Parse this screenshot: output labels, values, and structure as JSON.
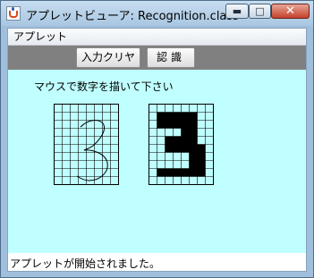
{
  "window": {
    "title": "アプレットビューア: Recognition.class",
    "minimize_symbol": "▬",
    "maximize_symbol": "□",
    "close_symbol": "✕"
  },
  "menu": {
    "items": [
      {
        "label": "アプレット"
      }
    ]
  },
  "toolbar": {
    "clear_label": "入力クリヤ",
    "recognize_label": "認識"
  },
  "canvas": {
    "instruction": "マウスで数字を描いて下さい",
    "background_color": "#c0ffff",
    "input_grid": {
      "cols": 8,
      "rows": 10,
      "handwritten_digit": "3"
    },
    "output_grid": {
      "cols": 8,
      "rows": 10,
      "filled_cells": [
        [
          1,
          1
        ],
        [
          2,
          1
        ],
        [
          3,
          1
        ],
        [
          4,
          1
        ],
        [
          5,
          1
        ],
        [
          1,
          2
        ],
        [
          2,
          2
        ],
        [
          3,
          2
        ],
        [
          4,
          2
        ],
        [
          5,
          2
        ],
        [
          4,
          3
        ],
        [
          5,
          3
        ],
        [
          2,
          4
        ],
        [
          3,
          4
        ],
        [
          4,
          4
        ],
        [
          5,
          4
        ],
        [
          2,
          5
        ],
        [
          3,
          5
        ],
        [
          4,
          5
        ],
        [
          5,
          5
        ],
        [
          6,
          5
        ],
        [
          5,
          6
        ],
        [
          6,
          6
        ],
        [
          5,
          7
        ],
        [
          6,
          7
        ],
        [
          1,
          8
        ],
        [
          2,
          8
        ],
        [
          3,
          8
        ],
        [
          4,
          8
        ],
        [
          5,
          8
        ],
        [
          6,
          8
        ]
      ]
    }
  },
  "status": {
    "text": "アプレットが開始されました。"
  }
}
